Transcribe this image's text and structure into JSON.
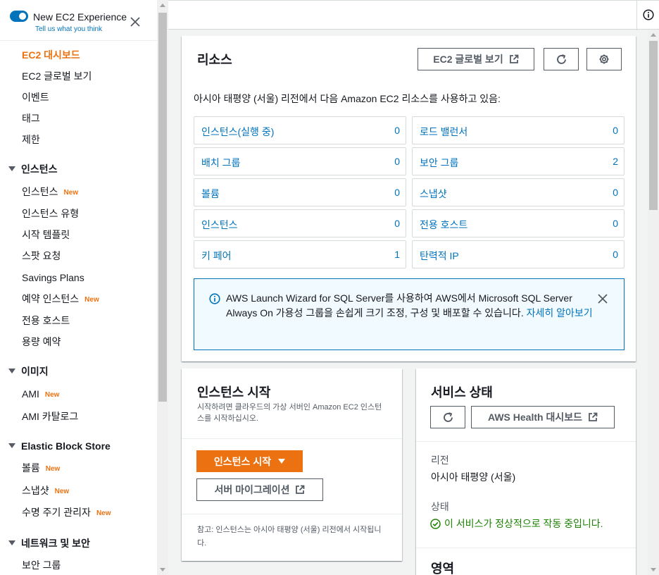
{
  "experience": {
    "title": "New EC2 Experience",
    "link": "Tell us what you think"
  },
  "sidebar": {
    "items": [
      {
        "label": "EC2 대시보드"
      },
      {
        "label": "EC2 글로벌 보기"
      },
      {
        "label": "이벤트"
      },
      {
        "label": "태그"
      },
      {
        "label": "제한"
      }
    ],
    "sections": [
      {
        "label": "인스턴스",
        "items": [
          {
            "label": "인스턴스",
            "badge": "New"
          },
          {
            "label": "인스턴스 유형"
          },
          {
            "label": "시작 템플릿"
          },
          {
            "label": "스팟 요청"
          },
          {
            "label": "Savings Plans"
          },
          {
            "label": "예약 인스턴스",
            "badge": "New"
          },
          {
            "label": "전용 호스트"
          },
          {
            "label": "용량 예약"
          }
        ]
      },
      {
        "label": "이미지",
        "items": [
          {
            "label": "AMI",
            "badge": "New"
          },
          {
            "label": "AMI 카탈로그"
          }
        ]
      },
      {
        "label": "Elastic Block Store",
        "items": [
          {
            "label": "볼륨",
            "badge": "New"
          },
          {
            "label": "스냅샷",
            "badge": "New"
          },
          {
            "label": "수명 주기 관리자",
            "badge": "New"
          }
        ]
      },
      {
        "label": "네트워크 및 보안",
        "items": [
          {
            "label": "보안 그룹"
          }
        ]
      }
    ]
  },
  "resources": {
    "title": "리소스",
    "global_view_button": "EC2 글로벌 보기",
    "description": "아시아 태평양 (서울) 리전에서 다음 Amazon EC2 리소스를 사용하고 있음:",
    "tiles": [
      {
        "label": "인스턴스(실행 중)",
        "value": "0"
      },
      {
        "label": "로드 밸런서",
        "value": "0"
      },
      {
        "label": "배치 그룹",
        "value": "0"
      },
      {
        "label": "보안 그룹",
        "value": "2"
      },
      {
        "label": "볼륨",
        "value": "0"
      },
      {
        "label": "스냅샷",
        "value": "0"
      },
      {
        "label": "인스턴스",
        "value": "0"
      },
      {
        "label": "전용 호스트",
        "value": "0"
      },
      {
        "label": "키 페어",
        "value": "1"
      },
      {
        "label": "탄력적 IP",
        "value": "0"
      }
    ],
    "alert": {
      "text": "AWS Launch Wizard for SQL Server를 사용하여 AWS에서 Microsoft SQL Server Always On 가용성 그룹을 손쉽게 크기 조정, 구성 및 배포할 수 있습니다. ",
      "link": "자세히 알아보기"
    }
  },
  "launch": {
    "title": "인스턴스 시작",
    "subtitle": "시작하려면 클라우드의 가상 서버인 Amazon EC2 인스턴스를 시작하십시오.",
    "launch_button": "인스턴스 시작",
    "migrate_button": "서버 마이그레이션",
    "note": "참고: 인스턴스는 아시아 태평양 (서울) 리전에서 시작됩니다."
  },
  "service_health": {
    "title": "서비스 상태",
    "dashboard_button": "AWS Health 대시보드",
    "region_label": "리전",
    "region_value": "아시아 태평양 (서울)",
    "status_label": "상태",
    "status_value": "이 서비스가 정상적으로 작동 중입니다.",
    "zones_title": "영역"
  },
  "colors": {
    "accent": "#ec7211",
    "link": "#0073bb",
    "success": "#1d8102"
  }
}
